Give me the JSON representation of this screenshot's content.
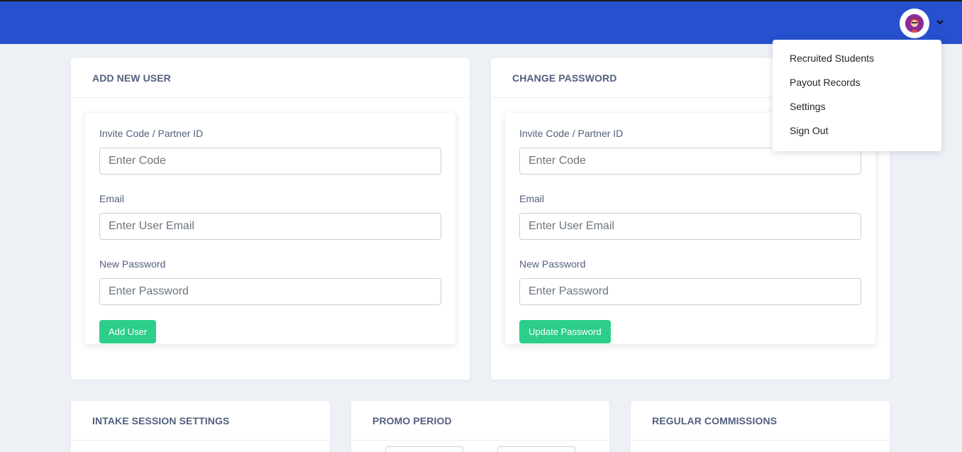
{
  "header": {
    "avatar_icon": "user-avatar-icon",
    "menu_chevron_icon": "chevron-down-icon",
    "brand_color": "#2650ce"
  },
  "user_menu": {
    "items": [
      {
        "label": "Recruited Students"
      },
      {
        "label": "Payout Records"
      },
      {
        "label": "Settings"
      },
      {
        "label": "Sign Out"
      }
    ]
  },
  "add_user": {
    "title": "ADD NEW USER",
    "code_label": "Invite Code / Partner ID",
    "code_placeholder": "Enter Code",
    "email_label": "Email",
    "email_placeholder": "Enter User Email",
    "password_label": "New Password",
    "password_placeholder": "Enter Password",
    "submit_label": "Add User"
  },
  "change_password": {
    "title": "CHANGE PASSWORD",
    "code_label": "Invite Code / Partner ID",
    "code_placeholder": "Enter Code",
    "email_label": "Email",
    "email_placeholder": "Enter User Email",
    "password_label": "New Password",
    "password_placeholder": "Enter Password",
    "submit_label": "Update Password"
  },
  "intake_session": {
    "title": "INTAKE SESSION SETTINGS"
  },
  "promo_period": {
    "title": "PROMO PERIOD"
  },
  "regular_commissions": {
    "title": "REGULAR COMMISSIONS"
  },
  "colors": {
    "accent_green": "#2dce89",
    "page_bg": "#edf1f6"
  }
}
